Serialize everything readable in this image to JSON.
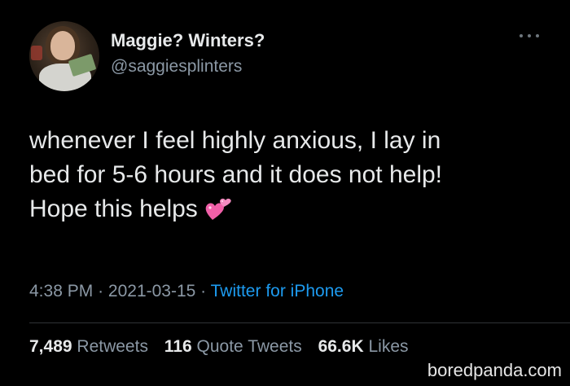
{
  "user": {
    "display_name": "Maggie? Winters?",
    "handle": "@saggiesplinters"
  },
  "tweet": {
    "lines": [
      "whenever I feel highly anxious, I lay in",
      "bed for 5-6 hours and it does not help!",
      "Hope this helps"
    ],
    "emoji": "two-hearts-icon"
  },
  "meta": {
    "time": "4:38 PM",
    "separator": "·",
    "date": "2021-03-15",
    "source": "Twitter for iPhone"
  },
  "stats": {
    "retweets_count": "7,489",
    "retweets_label": "Retweets",
    "quote_count": "116",
    "quote_label": "Quote Tweets",
    "likes_count": "66.6K",
    "likes_label": "Likes"
  },
  "watermark": "boredpanda.com",
  "colors": {
    "background": "#000000",
    "text_primary": "#e7e9ea",
    "text_secondary": "#8b98a5",
    "link": "#1d9bf0",
    "heart": "#f060a8"
  }
}
